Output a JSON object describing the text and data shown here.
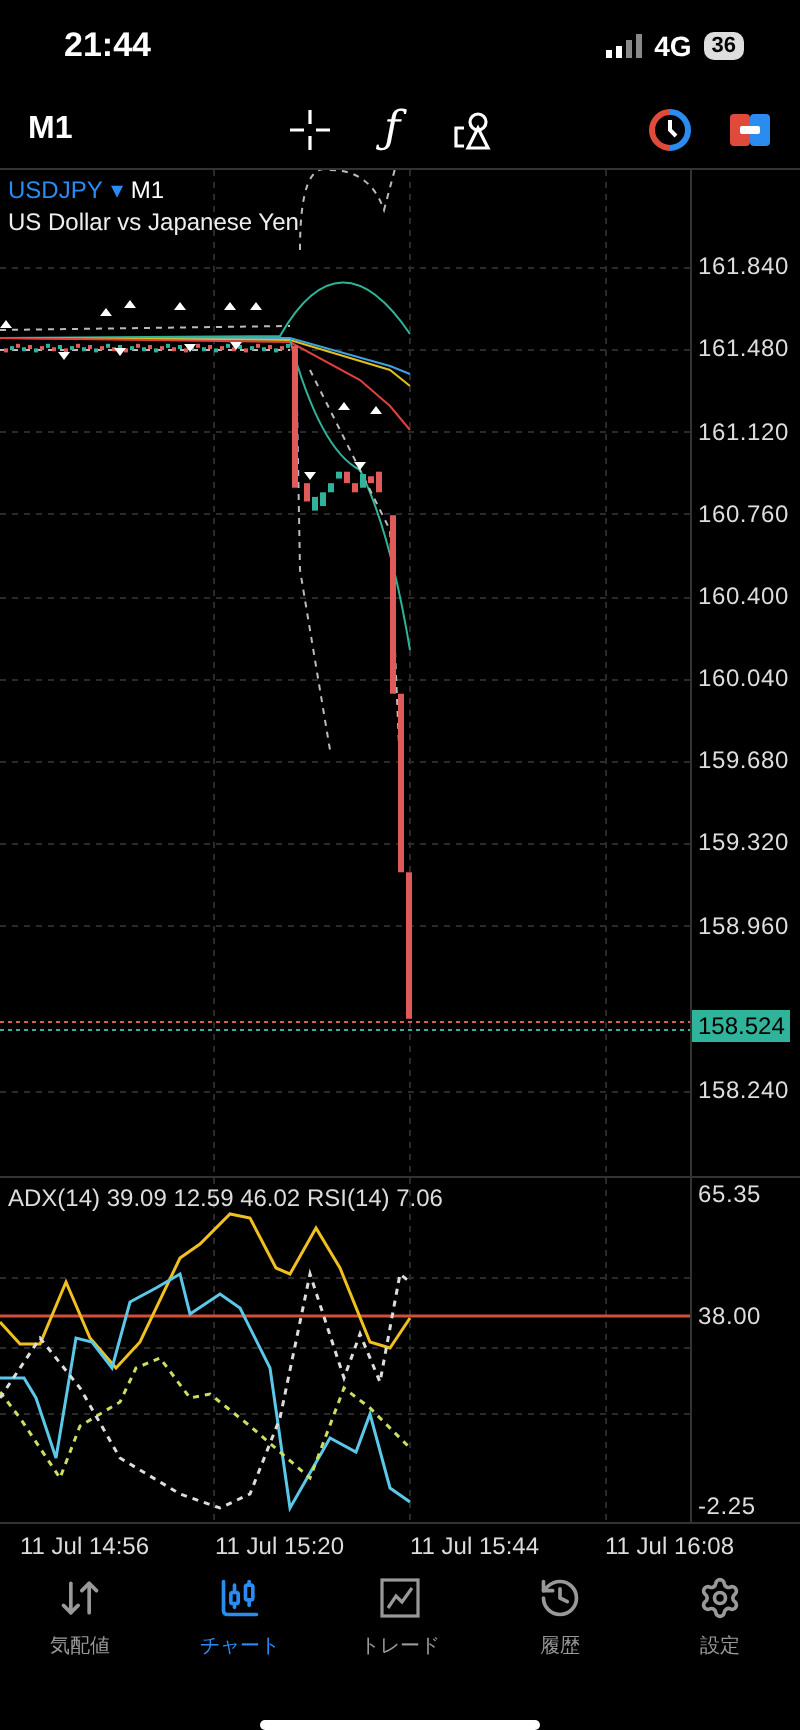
{
  "status_bar": {
    "time": "21:44",
    "network": "4G",
    "battery": "36"
  },
  "toolbar": {
    "timeframe": "M1",
    "function_glyph": "ƒ"
  },
  "chart": {
    "symbol": "USDJPY",
    "symbol_caret": "▾",
    "period": "M1",
    "description": "US Dollar vs Japanese Yen",
    "price_axis": [
      "161.840",
      "161.480",
      "161.120",
      "160.760",
      "160.400",
      "160.040",
      "159.680",
      "159.320",
      "158.960"
    ],
    "current_price": "158.524",
    "lower_price": "158.240",
    "indicator_header": "ADX(14) 39.09 12.59 46.02 RSI(14) 7.06",
    "indicator_axis": [
      "65.35",
      "38.00",
      "-2.25"
    ],
    "time_axis": [
      "11 Jul 14:56",
      "11 Jul 15:20",
      "11 Jul 15:44",
      "11 Jul 16:08"
    ]
  },
  "tabs": [
    {
      "label": "気配値",
      "kind": "quotes",
      "selected": false
    },
    {
      "label": "チャート",
      "kind": "chart",
      "selected": true
    },
    {
      "label": "トレード",
      "kind": "trade",
      "selected": false
    },
    {
      "label": "履歴",
      "kind": "history",
      "selected": false
    },
    {
      "label": "設定",
      "kind": "settings",
      "selected": false
    }
  ]
}
